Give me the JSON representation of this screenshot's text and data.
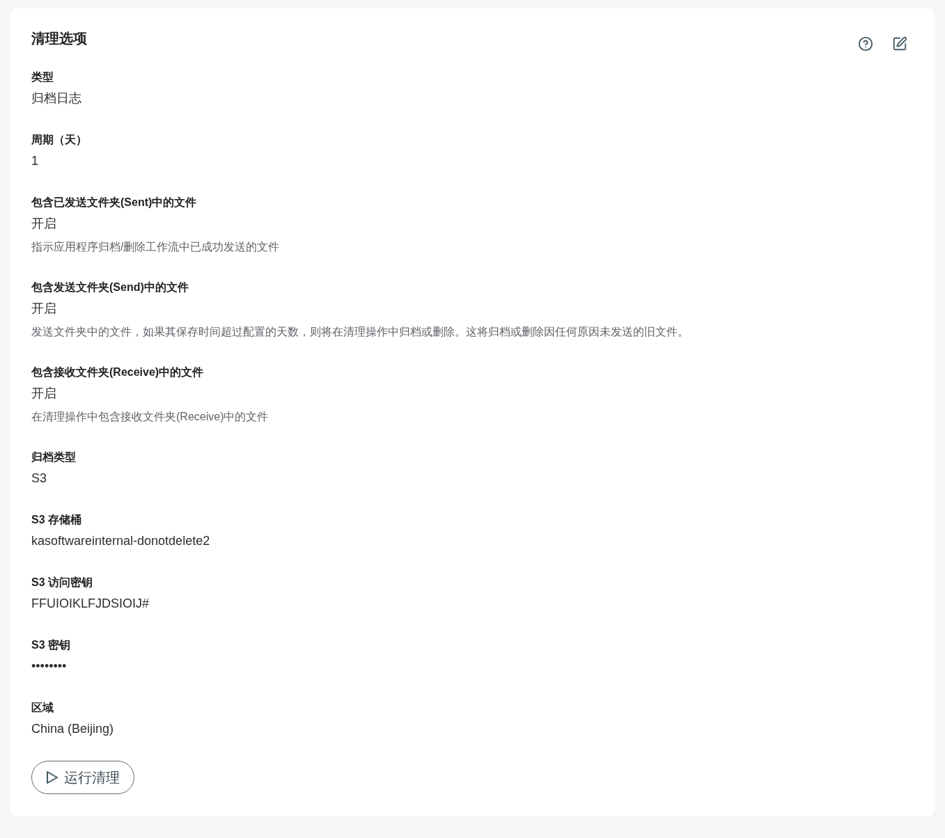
{
  "panel": {
    "title": "清理选项"
  },
  "fields": [
    {
      "label": "类型",
      "value": "归档日志"
    },
    {
      "label": "周期（天）",
      "value": "1"
    },
    {
      "label": "包含已发送文件夹(Sent)中的文件",
      "value": "开启",
      "description": "指示应用程序归档/删除工作流中已成功发送的文件"
    },
    {
      "label": "包含发送文件夹(Send)中的文件",
      "value": "开启",
      "description": "发送文件夹中的文件，如果其保存时间超过配置的天数，则将在清理操作中归档或删除。这将归档或删除因任何原因未发送的旧文件。"
    },
    {
      "label": "包含接收文件夹(Receive)中的文件",
      "value": "开启",
      "description": "在清理操作中包含接收文件夹(Receive)中的文件"
    },
    {
      "label": "归档类型",
      "value": "S3"
    },
    {
      "label": "S3 存储桶",
      "value": "kasoftwareinternal-donotdelete2"
    },
    {
      "label": "S3 访问密钥",
      "value": "FFUIOIKLFJDSIOIJ#"
    },
    {
      "label": "S3 密钥",
      "value": "••••••••"
    },
    {
      "label": "区域",
      "value": "China (Beijing)"
    }
  ],
  "run_button": {
    "label": "运行清理"
  }
}
